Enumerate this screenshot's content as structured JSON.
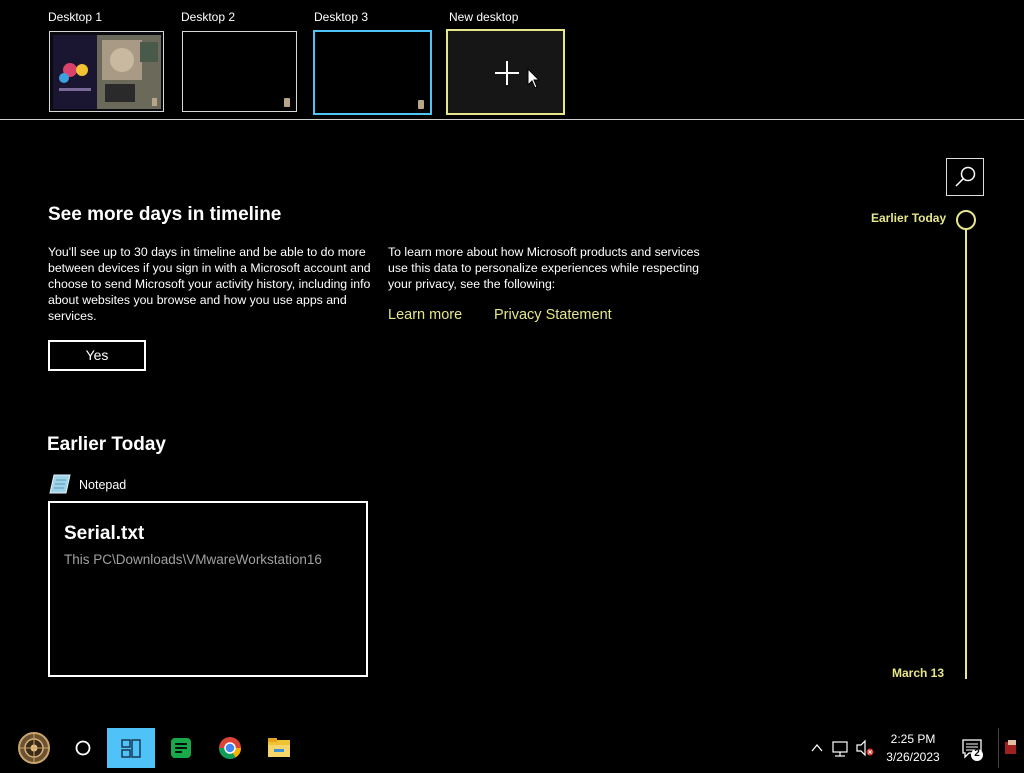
{
  "desktops": [
    {
      "label": "Desktop 1"
    },
    {
      "label": "Desktop 2"
    },
    {
      "label": "Desktop 3"
    },
    {
      "label": "New desktop"
    }
  ],
  "banner": {
    "title": "See more days in timeline",
    "body_left": "You'll see up to 30 days in timeline and be able to do more between devices if you sign in with a Microsoft account and choose to send Microsoft your activity history, including info about websites you browse and how you use apps and services.",
    "body_right": "To learn more about how Microsoft products and services use this data to personalize experiences while respecting your privacy, see the following:",
    "learn_more": "Learn more",
    "privacy": "Privacy Statement",
    "yes_button": "Yes"
  },
  "section": {
    "title": "Earlier Today",
    "app_name": "Notepad",
    "card_title": "Serial.txt",
    "card_path": "This PC\\Downloads\\VMwareWorkstation16"
  },
  "timeline": {
    "top_label": "Earlier Today",
    "bottom_label": "March 13"
  },
  "taskbar": {
    "time": "2:25 PM",
    "date": "3/26/2023",
    "notification_count": "2"
  },
  "colors": {
    "accent_yellow": "#e6e68a",
    "active_desktop_border": "#4fc3f7",
    "task_view_active": "#4fc3f7"
  }
}
